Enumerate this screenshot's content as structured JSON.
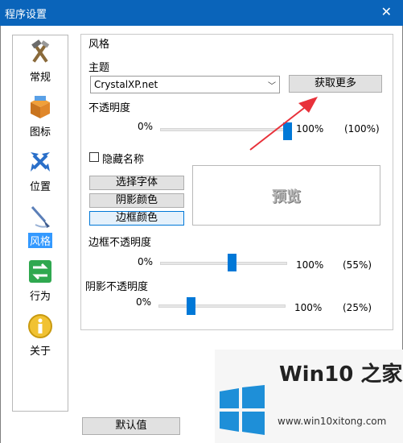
{
  "window": {
    "title": "程序设置",
    "close_glyph": "✕"
  },
  "sidebar": {
    "items": [
      {
        "label": "常规",
        "icon": "tools-icon"
      },
      {
        "label": "图标",
        "icon": "package-icon"
      },
      {
        "label": "位置",
        "icon": "move-arrows-icon"
      },
      {
        "label": "风格",
        "icon": "brush-icon",
        "active": true
      },
      {
        "label": "行为",
        "icon": "exchange-arrows-icon"
      },
      {
        "label": "关于",
        "icon": "info-icon"
      }
    ]
  },
  "style_panel": {
    "section_title": "风格",
    "theme_label": "主题",
    "theme_value": "CrystalXP.net",
    "get_more_button": "获取更多",
    "opacity_label": "不透明度",
    "opacity": {
      "min": "0%",
      "max": "100%",
      "value_text": "(100%)",
      "value": 1.0
    },
    "hide_name_label": "隐藏名称",
    "hide_name_checked": false,
    "buttons": {
      "select_font": "选择字体",
      "shadow_color": "阴影颜色",
      "border_color": "边框颜色"
    },
    "preview_text": "预览",
    "border_opacity_label": "边框不透明度",
    "border_opacity": {
      "min": "0%",
      "max": "100%",
      "value_text": "(55%)",
      "value": 0.55
    },
    "shadow_opacity_label": "阴影不透明度",
    "shadow_opacity": {
      "min": "0%",
      "max": "100%",
      "value_text": "(25%)",
      "value": 0.25
    }
  },
  "default_button": "默认值",
  "watermark": {
    "title": "Win10 之家",
    "domain": "www.win10xitong.com",
    "accent": "#1e8fd8"
  },
  "colors": {
    "titlebar": "#0a64ba",
    "accent": "#0078d7",
    "arrow": "#e8313a"
  }
}
